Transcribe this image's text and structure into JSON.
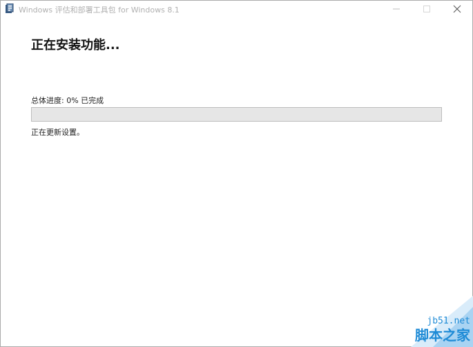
{
  "window": {
    "title": "Windows 评估和部署工具包 for Windows 8.1",
    "app_icon": "setup-package-icon",
    "controls": {
      "minimize": "minimize-icon",
      "maximize": "maximize-icon",
      "close": "close-icon"
    }
  },
  "installer": {
    "heading": "正在安装功能...",
    "progress_label": "总体进度: 0% 已完成",
    "progress_fraction": 0,
    "status": "正在更新设置。"
  },
  "watermark": {
    "site": "jb51.net",
    "name": "脚本之家"
  },
  "colors": {
    "progress_track": "#e6e6e6",
    "progress_fill": "#06b025",
    "watermark": "#1e8bd6"
  }
}
